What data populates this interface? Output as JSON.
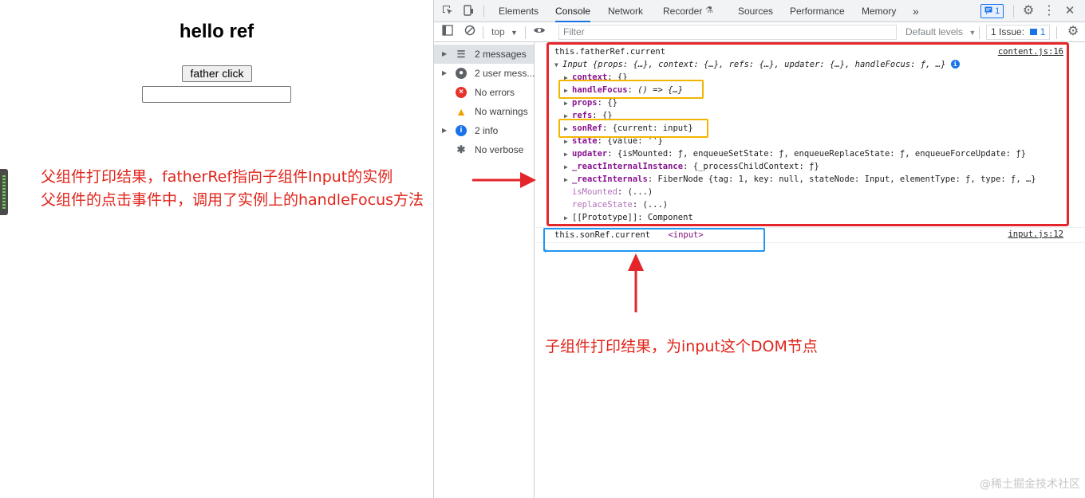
{
  "page": {
    "heading": "hello ref",
    "button_label": "father click",
    "input_value": ""
  },
  "annotations": {
    "line1": "父组件打印结果，fatherRef指向子组件Input的实例",
    "line2": "父组件的点击事件中，调用了实例上的handleFocus方法",
    "line3": "子组件打印结果，为input这个DOM节点"
  },
  "devtools": {
    "tabs": [
      "Elements",
      "Console",
      "Network",
      "Recorder",
      "Sources",
      "Performance",
      "Memory"
    ],
    "active_tab": "Console",
    "more_tabs": "»",
    "issues_badge": "1",
    "toolbar": {
      "context": "top",
      "filter_placeholder": "Filter",
      "levels": "Default levels",
      "issues": "1 Issue:",
      "issues_count": "1"
    },
    "sidebar": [
      {
        "label": "2 messages",
        "icon": "list-icon",
        "expandable": true,
        "selected": true
      },
      {
        "label": "2 user mess...",
        "icon": "user-icon",
        "expandable": true,
        "selected": false
      },
      {
        "label": "No errors",
        "icon": "error-icon",
        "expandable": false,
        "selected": false
      },
      {
        "label": "No warnings",
        "icon": "warning-icon",
        "expandable": false,
        "selected": false
      },
      {
        "label": "2 info",
        "icon": "info-icon",
        "expandable": true,
        "selected": false
      },
      {
        "label": "No verbose",
        "icon": "bug-icon",
        "expandable": false,
        "selected": false
      }
    ],
    "console": {
      "msg1_text": "this.fatherRef.current",
      "msg1_source": "content.js:16",
      "obj_summary": "Input {props: {…}, context: {…}, refs: {…}, updater: {…}, handleFocus: ƒ, …}",
      "props": [
        {
          "key": "context",
          "value": "{}",
          "expandable": true,
          "dim": false
        },
        {
          "key": "handleFocus",
          "value": "() => {…}",
          "expandable": true,
          "dim": false
        },
        {
          "key": "props",
          "value": "{}",
          "expandable": true,
          "dim": false
        },
        {
          "key": "refs",
          "value": "{}",
          "expandable": true,
          "dim": false
        },
        {
          "key": "sonRef",
          "value": "{current: input}",
          "expandable": true,
          "dim": false
        },
        {
          "key": "state",
          "value": "{value: ''}",
          "expandable": true,
          "dim": false
        },
        {
          "key": "updater",
          "value": "{isMounted: ƒ, enqueueSetState: ƒ, enqueueReplaceState: ƒ, enqueueForceUpdate: ƒ}",
          "expandable": true,
          "dim": false
        },
        {
          "key": "_reactInternalInstance",
          "value": "{_processChildContext: ƒ}",
          "expandable": true,
          "dim": false
        },
        {
          "key": "_reactInternals",
          "value": "FiberNode {tag: 1, key: null, stateNode: Input, elementType: ƒ, type: ƒ, …}",
          "expandable": true,
          "dim": false
        },
        {
          "key": "isMounted",
          "value": "(...)",
          "expandable": false,
          "dim": true
        },
        {
          "key": "replaceState",
          "value": "(...)",
          "expandable": false,
          "dim": true
        },
        {
          "key": "[[Prototype]]",
          "value": "Component",
          "expandable": true,
          "dim": false,
          "plain": true
        }
      ],
      "msg2_text": "this.sonRef.current",
      "msg2_value": "<input>",
      "msg2_source": "input.js:12",
      "prompt": "›"
    }
  },
  "watermark": "@稀土掘金技术社区",
  "colors": {
    "annotation_red": "#e0241a",
    "box_red": "#e4262a",
    "box_orange": "#f2b600",
    "box_blue": "#2196f3",
    "devtools_accent": "#1a73e8"
  }
}
